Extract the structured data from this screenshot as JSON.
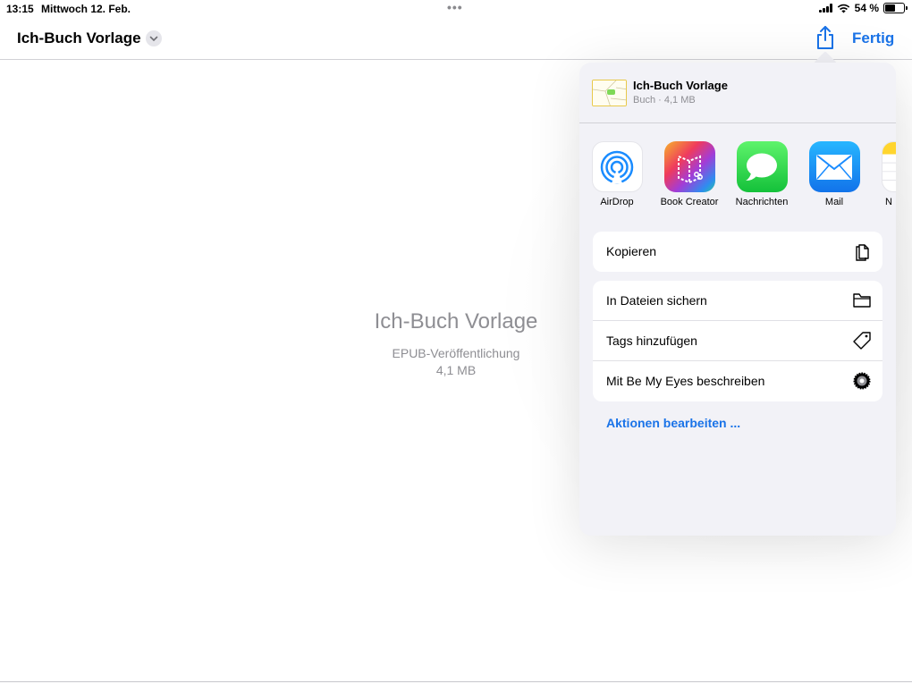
{
  "status_bar": {
    "time": "13:15",
    "date": "Mittwoch 12. Feb.",
    "battery_percent": "54 %",
    "battery_level": 0.54
  },
  "nav": {
    "title": "Ich-Buch Vorlage",
    "done_label": "Fertig"
  },
  "preview": {
    "title": "Ich-Buch Vorlage",
    "type": "EPUB-Veröffentlichung",
    "size": "4,1 MB"
  },
  "share_sheet": {
    "title": "Ich-Buch Vorlage",
    "subtitle": "Buch · 4,1 MB",
    "apps": [
      {
        "label": "AirDrop",
        "icon": "airdrop-icon"
      },
      {
        "label": "Book Creator",
        "icon": "book-creator-icon"
      },
      {
        "label": "Nachrichten",
        "icon": "messages-icon"
      },
      {
        "label": "Mail",
        "icon": "mail-icon"
      },
      {
        "label": "N",
        "icon": "notes-icon"
      }
    ],
    "actions_group1": [
      {
        "label": "Kopieren",
        "icon": "copy-icon"
      }
    ],
    "actions_group2": [
      {
        "label": "In Dateien sichern",
        "icon": "folder-icon"
      },
      {
        "label": "Tags hinzufügen",
        "icon": "tag-icon"
      },
      {
        "label": "Mit Be My Eyes beschreiben",
        "icon": "gear-icon"
      }
    ],
    "edit_actions_label": "Aktionen bearbeiten ..."
  },
  "colors": {
    "accent": "#1a73e8",
    "sheet_bg": "#f2f2f7",
    "secondary_text": "#8e8e93"
  }
}
